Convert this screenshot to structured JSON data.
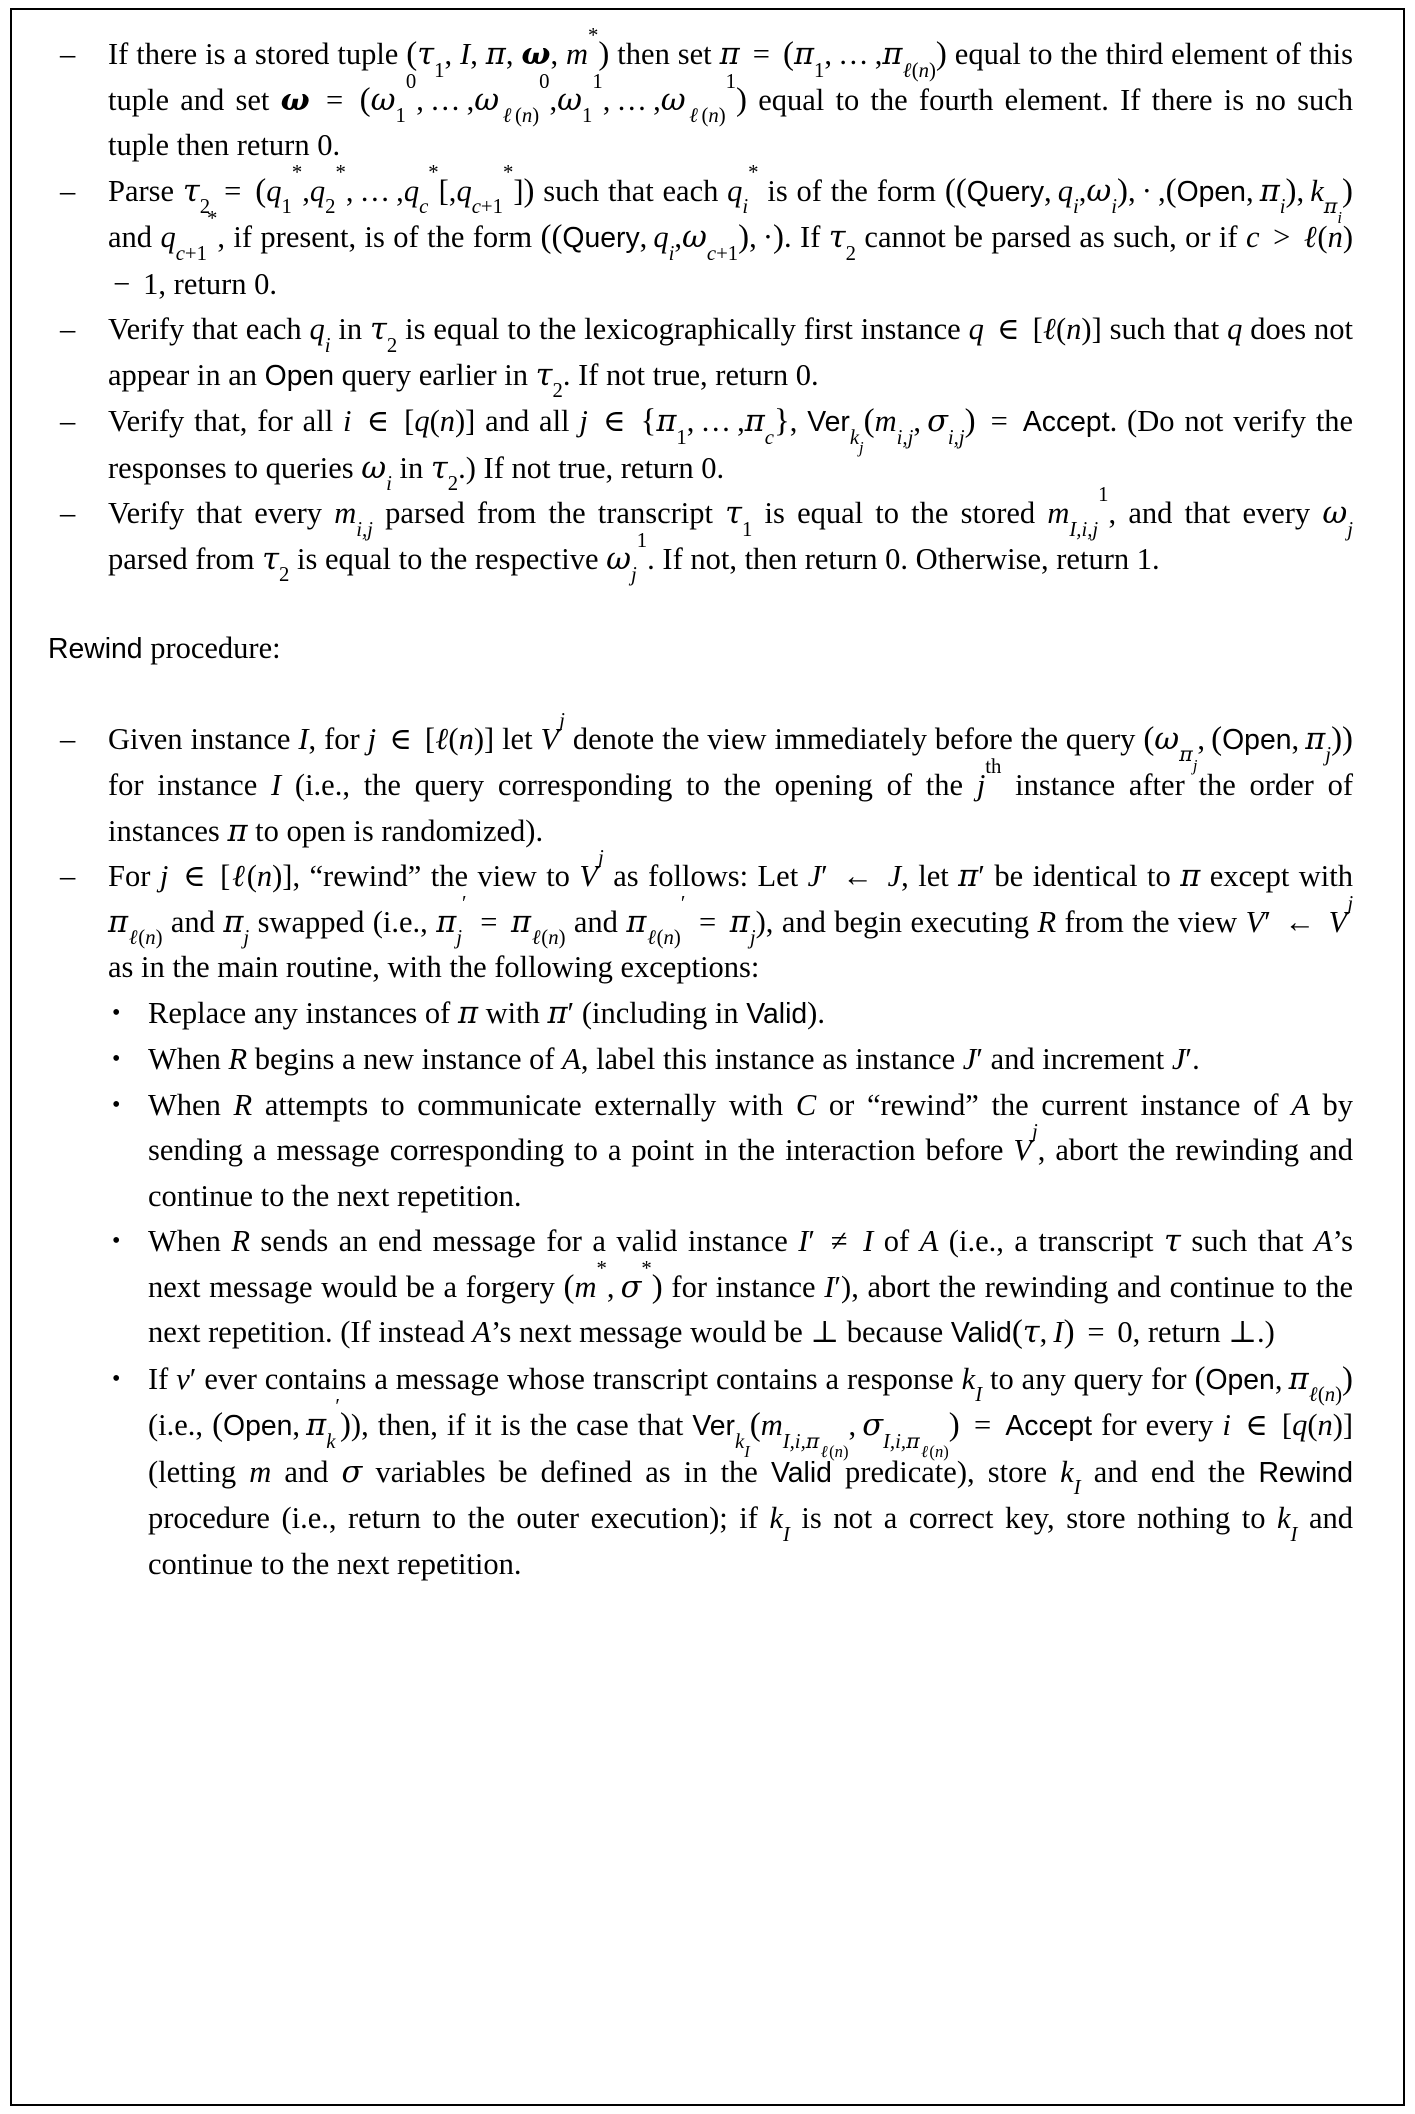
{
  "document": {
    "type": "academic-paper-page",
    "sections": [
      {
        "id": "valid-predicate-steps",
        "kind": "dash-list",
        "items": [
          {
            "id": "stored-tuple",
            "text": "If there is a stored tuple (τ₁, I, π, ω, m*) then set π = (π₁, …, π_{ℓ(n)}) equal to the third element of this tuple and set ω = (ω⁰₁, …, ω⁰_{ℓ(n)}, ω¹₁, …, ω¹_{ℓ(n)}) equal to the fourth element. If there is no such tuple then return 0."
          },
          {
            "id": "parse-tau2",
            "text": "Parse τ₂ = (q*₁, q*₂, …, q*_c[, q*_{c+1}]) such that each q*_i is of the form ((Query, q_i, ω_i), ·, (Open, π_i), k_{π_i}) and q*_{c+1}, if present, is of the form ((Query, q_i, ω_{c+1}), ·). If τ₂ cannot be parsed as such, or if c > ℓ(n) − 1, return 0."
          },
          {
            "id": "verify-lexicographic",
            "text": "Verify that each q_i in τ₂ is equal to the lexicographically first instance q ∈ [ℓ(n)] such that q does not appear in an Open query earlier in τ₂. If not true, return 0."
          },
          {
            "id": "verify-signatures",
            "text": "Verify that, for all i ∈ [q(n)] and all j ∈ {π₁, …, π_c}, Ver_{k_j}(m_{i,j}, σ_{i,j}) = Accept. (Do not verify the responses to queries ω_i in τ₂.) If not true, return 0."
          },
          {
            "id": "verify-messages",
            "text": "Verify that every m_{i,j} parsed from the transcript τ₁ is equal to the stored m¹_{I,i,j}, and that every ω_j parsed from τ₂ is equal to the respective ω¹_j. If not, then return 0. Otherwise, return 1."
          }
        ]
      },
      {
        "id": "rewind-heading",
        "kind": "heading",
        "label": "Rewind",
        "suffix": " procedure:"
      },
      {
        "id": "rewind-steps",
        "kind": "dash-list",
        "items": [
          {
            "id": "given-instance",
            "text": "Given instance I, for j ∈ [ℓ(n)] let V^j denote the view immediately before the query (ω_{π_j}, (Open, π_j)) for instance I (i.e., the query corresponding to the opening of the j-th instance after the order of instances π to open is randomized)."
          },
          {
            "id": "for-j-rewind",
            "text": "For j ∈ [ℓ(n)], \"rewind\" the view to V^j as follows: Let J′ ← J, let π′ be identical to π except with π_{ℓ(n)} and π_j swapped (i.e., π′_j = π_{ℓ(n)} and π′_{ℓ(n)} = π_j), and begin executing R from the view V′ ← V^j as in the main routine, with the following exceptions:"
          }
        ]
      },
      {
        "id": "rewind-exceptions",
        "kind": "bullet-list",
        "items": [
          {
            "id": "replace-pi",
            "text": "Replace any instances of π with π′ (including in Valid)."
          },
          {
            "id": "label-instance",
            "text": "When R begins a new instance of A, label this instance as instance J′ and increment J′."
          },
          {
            "id": "communicate-externally",
            "text": "When R attempts to communicate externally with C or \"rewind\" the current instance of A by sending a message corresponding to a point in the interaction before V^j, abort the rewinding and continue to the next repetition."
          },
          {
            "id": "end-message",
            "text": "When R sends an end message for a valid instance I′ ≠ I of A (i.e., a transcript τ such that A's next message would be a forgery (m*, σ*) for instance I′), abort the rewinding and continue to the next repetition. (If instead A's next message would be ⊥ because Valid(τ, I) = 0, return ⊥.)"
          },
          {
            "id": "contains-response",
            "text": "If v′ ever contains a message whose transcript contains a response k_I to any query for (Open, π_{ℓ(n)}) (i.e., (Open, π′_k)), then, if it is the case that Ver_{k_I}(m_{I,i,π_{ℓ(n)}}, σ_{I,i,π_{ℓ(n)}}) = Accept for every i ∈ [q(n)] (letting m and σ variables be defined as in the Valid predicate), store k_I and end the Rewind procedure (i.e., return to the outer execution); if k_I is not a correct key, store nothing to k_I and continue to the next repetition."
          }
        ]
      }
    ],
    "markers": {
      "dash": "–",
      "bullet": "•"
    },
    "keywords": {
      "query": "Query",
      "open": "Open",
      "accept": "Accept",
      "ver": "Ver",
      "valid": "Valid",
      "rewind": "Rewind"
    },
    "colors": {
      "background": "#ffffff",
      "text": "#000000",
      "border": "#000000"
    }
  }
}
